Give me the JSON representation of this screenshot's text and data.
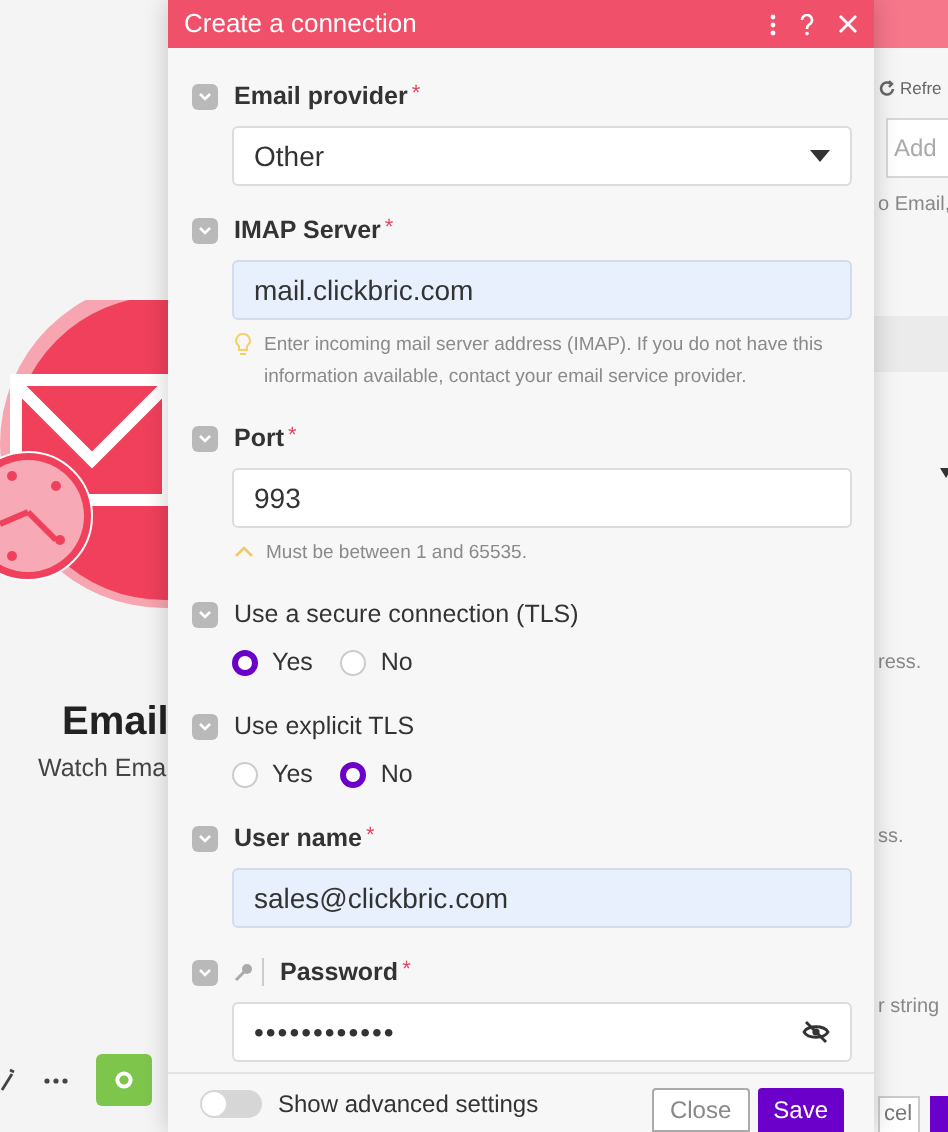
{
  "background": {
    "left": {
      "title": "Email",
      "subtitle": "Watch Ema"
    },
    "right": {
      "refresh": "Refre",
      "add_field": "Add",
      "note_1": "o Email,",
      "note_2": "ress.",
      "note_3": "ss.",
      "note_4": "r string",
      "cancel": "cel"
    }
  },
  "dialog": {
    "title": "Create a connection",
    "fields": [
      {
        "kind": "select",
        "label": "Email provider",
        "required": true,
        "mark": "*",
        "value": "Other"
      },
      {
        "kind": "text",
        "label": "IMAP Server",
        "required": true,
        "mark": "*",
        "value": "mail.clickbric.com",
        "autofilled": true,
        "hint": {
          "kind": "tip",
          "text": "Enter incoming mail server address (IMAP). If you do not have this information available, contact your email service provider."
        }
      },
      {
        "kind": "text",
        "label": "Port",
        "required": true,
        "mark": "*",
        "value": "993",
        "autofilled": false,
        "hint": {
          "kind": "warning",
          "text": "Must be between 1 and 65535."
        }
      },
      {
        "kind": "radio",
        "label": "Use a secure connection (TLS)",
        "required": false,
        "options": [
          {
            "label": "Yes",
            "selected": true
          },
          {
            "label": "No",
            "selected": false
          }
        ]
      },
      {
        "kind": "radio",
        "label": "Use explicit TLS",
        "required": false,
        "options": [
          {
            "label": "Yes",
            "selected": false
          },
          {
            "label": "No",
            "selected": true
          }
        ]
      },
      {
        "kind": "text",
        "label": "User name",
        "required": true,
        "mark": "*",
        "value": "sales@clickbric.com",
        "autofilled": true
      },
      {
        "kind": "password",
        "label": "Password",
        "required": true,
        "mark": "*",
        "value": "••••••••••••"
      }
    ],
    "advanced": {
      "label": "Show advanced settings",
      "on": false
    },
    "buttons": [
      {
        "label": "Close",
        "kind": "secondary"
      },
      {
        "label": "Save",
        "kind": "primary"
      }
    ]
  }
}
